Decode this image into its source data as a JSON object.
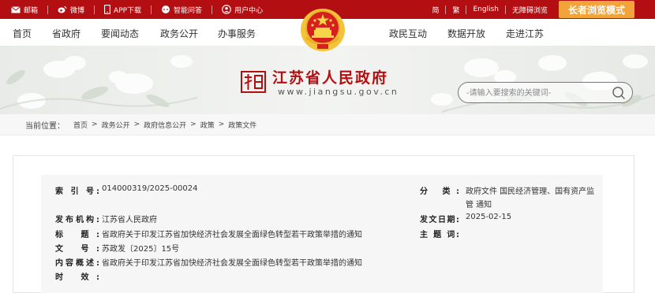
{
  "topbar": {
    "left": [
      {
        "label": "邮箱",
        "icon": "mail-icon"
      },
      {
        "label": "微博",
        "icon": "weibo-icon"
      },
      {
        "label": "APP下载",
        "icon": "phone-icon"
      },
      {
        "label": "智能问答",
        "icon": "chat-icon"
      },
      {
        "label": "用户中心",
        "icon": "user-icon"
      }
    ],
    "right": [
      "简",
      "繁",
      "English",
      "无障碍浏览"
    ],
    "elder_mode": "长者浏览模式"
  },
  "nav": {
    "left": [
      "首页",
      "省政府",
      "要闻动态",
      "政务公开",
      "办事服务"
    ],
    "right": [
      "政民互动",
      "数据开放",
      "走进江苏"
    ]
  },
  "header": {
    "site_title": "江苏省人民政府",
    "site_url": "www.jiangsu.gov.cn",
    "search_placeholder": "-请输入要搜索的关键词-"
  },
  "breadcrumb": {
    "label": "当前位置：",
    "items": [
      "首页",
      "政务公开",
      "政府信息公开",
      "政策",
      "政策文件"
    ]
  },
  "doc_info": {
    "index_label": "索 引 号:",
    "index_value": "014000319/2025-00024",
    "category_label": "分 类:",
    "category_value_line1": "政府文件 国民经济管理、国有资产监",
    "category_value_line2": "管 通知",
    "issuer_label": "发布机构:",
    "issuer_value": "江苏省人民政府",
    "date_label": "发文日期:",
    "date_value": "2025-02-15",
    "title_label": "标 题:",
    "title_value": "省政府关于印发江苏省加快经济社会发展全面绿色转型若干政策举措的通知",
    "subject_label": "主 题 词:",
    "subject_value": "",
    "docno_label": "文 号:",
    "docno_value": "苏政发〔2025〕15号",
    "summary_label": "内容概述:",
    "summary_value": "省政府关于印发江苏省加快经济社会发展全面绿色转型若干政策举措的通知",
    "validity_label": "时 效:",
    "validity_value": ""
  },
  "colors": {
    "topbar_red": "#b30f12",
    "elder_orange": "#f2a43b",
    "title_red": "#b30f12"
  }
}
